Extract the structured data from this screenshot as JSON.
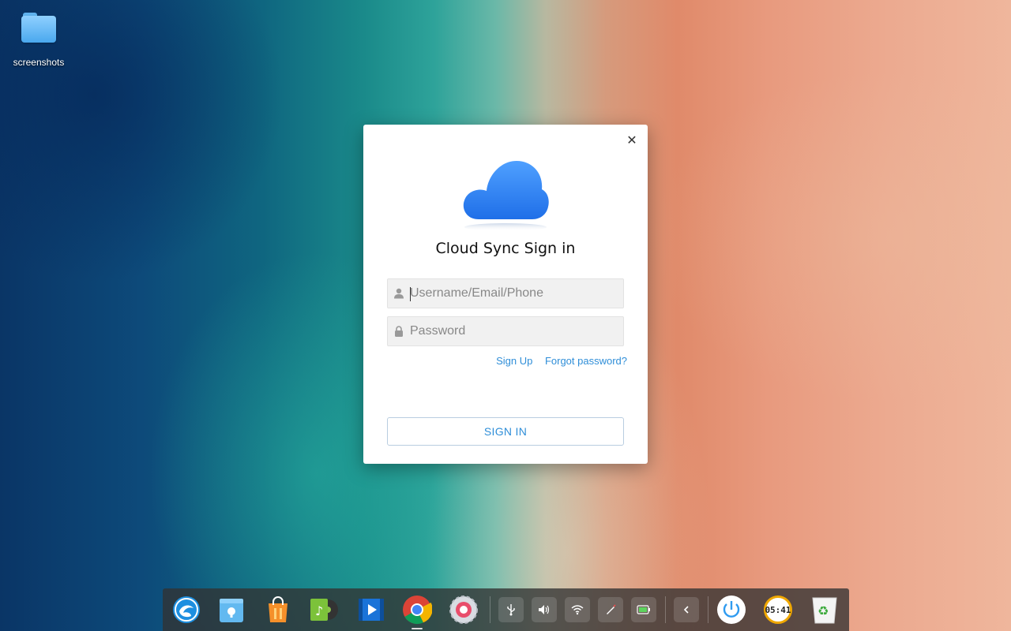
{
  "desktop": {
    "icons": [
      {
        "label": "screenshots",
        "icon": "folder-icon"
      }
    ]
  },
  "dialog": {
    "title": "Cloud Sync Sign in",
    "logo": "cloud-icon",
    "close_icon": "close-icon",
    "username": {
      "value": "",
      "placeholder": "Username/Email/Phone",
      "icon": "user-icon"
    },
    "password": {
      "value": "",
      "placeholder": "Password",
      "icon": "lock-icon"
    },
    "links": {
      "sign_up": "Sign Up",
      "forgot_password": "Forgot password?"
    },
    "sign_in_label": "SIGN IN"
  },
  "dock": {
    "apps": [
      {
        "name": "launcher",
        "icon": "deepin-launcher-icon"
      },
      {
        "name": "file-vault",
        "icon": "file-vault-icon"
      },
      {
        "name": "app-store",
        "icon": "app-store-icon"
      },
      {
        "name": "music",
        "icon": "music-icon"
      },
      {
        "name": "video",
        "icon": "video-player-icon"
      },
      {
        "name": "browser",
        "icon": "chrome-icon"
      },
      {
        "name": "settings",
        "icon": "settings-icon"
      }
    ],
    "tray": [
      {
        "name": "usb",
        "icon": "usb-icon"
      },
      {
        "name": "volume",
        "icon": "volume-icon"
      },
      {
        "name": "wifi",
        "icon": "wifi-icon"
      },
      {
        "name": "pen",
        "icon": "pen-icon"
      },
      {
        "name": "battery",
        "icon": "battery-icon"
      },
      {
        "name": "collapse",
        "icon": "chevron-left-icon"
      }
    ],
    "power_icon": "power-icon",
    "clock_text": "05:41",
    "trash_icon": "trash-icon",
    "colors": {
      "accent": "#2f8ed8",
      "cloud": "#2f7ff0"
    }
  }
}
